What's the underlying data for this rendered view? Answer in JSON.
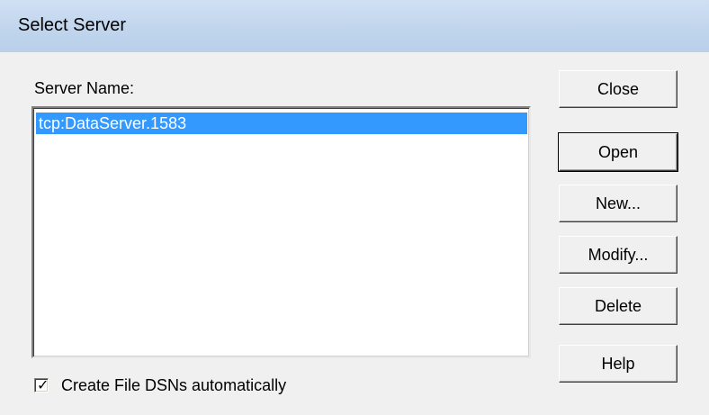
{
  "window": {
    "title": "Select Server"
  },
  "server_list": {
    "label": "Server Name:",
    "items": [
      {
        "name": "tcp:DataServer.1583",
        "selected": true
      }
    ]
  },
  "buttons": {
    "close": "Close",
    "open": "Open",
    "new": "New...",
    "modify": "Modify...",
    "delete": "Delete",
    "help": "Help"
  },
  "options": {
    "create_file_dsns_label": "Create File DSNs automatically",
    "create_file_dsns_checked": true
  },
  "colors": {
    "selection": "#3399ff",
    "titlebar": "#c4d7ee",
    "window_bg": "#f0f0f0"
  }
}
